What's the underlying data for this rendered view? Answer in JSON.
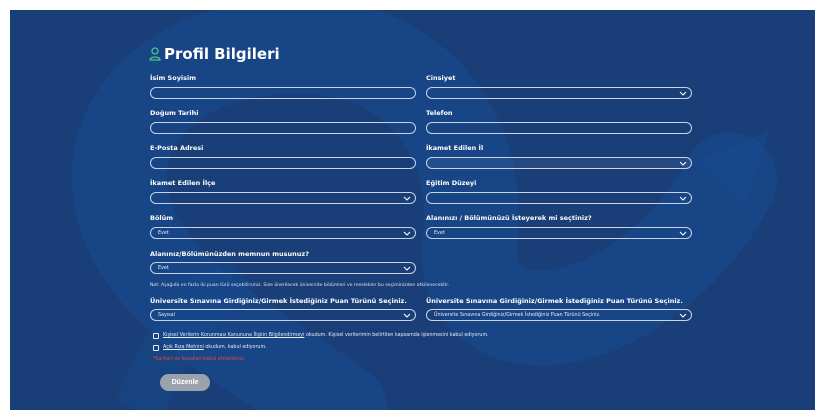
{
  "page": {
    "title": "Profil Bilgileri",
    "title_icon": "user-icon",
    "accent": "#4cc38a",
    "background": "#1a3f78"
  },
  "form": {
    "name": {
      "label": "İsim Soyisim",
      "value": ""
    },
    "gender": {
      "label": "Cinsiyet",
      "value": ""
    },
    "birthdate": {
      "label": "Doğum Tarihi",
      "value": ""
    },
    "phone": {
      "label": "Telefon",
      "value": ""
    },
    "email": {
      "label": "E-Posta Adresi",
      "value": ""
    },
    "city": {
      "label": "İkamet Edilen İl",
      "value": ""
    },
    "district": {
      "label": "İkamet Edilen İlçe",
      "value": ""
    },
    "education": {
      "label": "Eğitim Düzeyi",
      "value": ""
    },
    "department": {
      "label": "Bölüm",
      "value": "Evet"
    },
    "chose_willingly": {
      "label": "Alanınızı / Bölümünüzü İsteyerek mi seçtiniz?",
      "value": "Evet"
    },
    "satisfied": {
      "label": "Alanınız/Bölümünüzden memnun musunuz?",
      "value": "Evet"
    },
    "note": "Not: Aşağıda en fazla iki puan türü seçebilirsiniz. Size önerilecek üniversite bölümleri ve meslekler bu seçiminizden etkilenecektir.",
    "score_type_1": {
      "label": "Üniversite Sınavına Girdiğiniz/Girmek İstediğiniz Puan Türünü Seçiniz.",
      "value": "Sayısal"
    },
    "score_type_2": {
      "label": "Üniversite Sınavına Girdiğiniz/Girmek İstediğiniz Puan Türünü Seçiniz.",
      "value": "Üniversite Sınavına Girdiğiniz/Girmek İstediğiniz Puan Türünü Seçiniz."
    }
  },
  "consents": {
    "kvkk_link": "Kişisel Verilerin Korunması Kanununa İlişkin Bilgilendirmeyi",
    "kvkk_text": " okudum. Kişisel verilerimin belirtilen kapsamda işlenmesini kabul ediyorum.",
    "consent_link": "Açık Rıza Metnini",
    "consent_text": " okudum, kabul ediyorum.",
    "error": "*Sartlari ve kosullari kabul etmelisiniz."
  },
  "submit": {
    "label": "Düzenle"
  }
}
